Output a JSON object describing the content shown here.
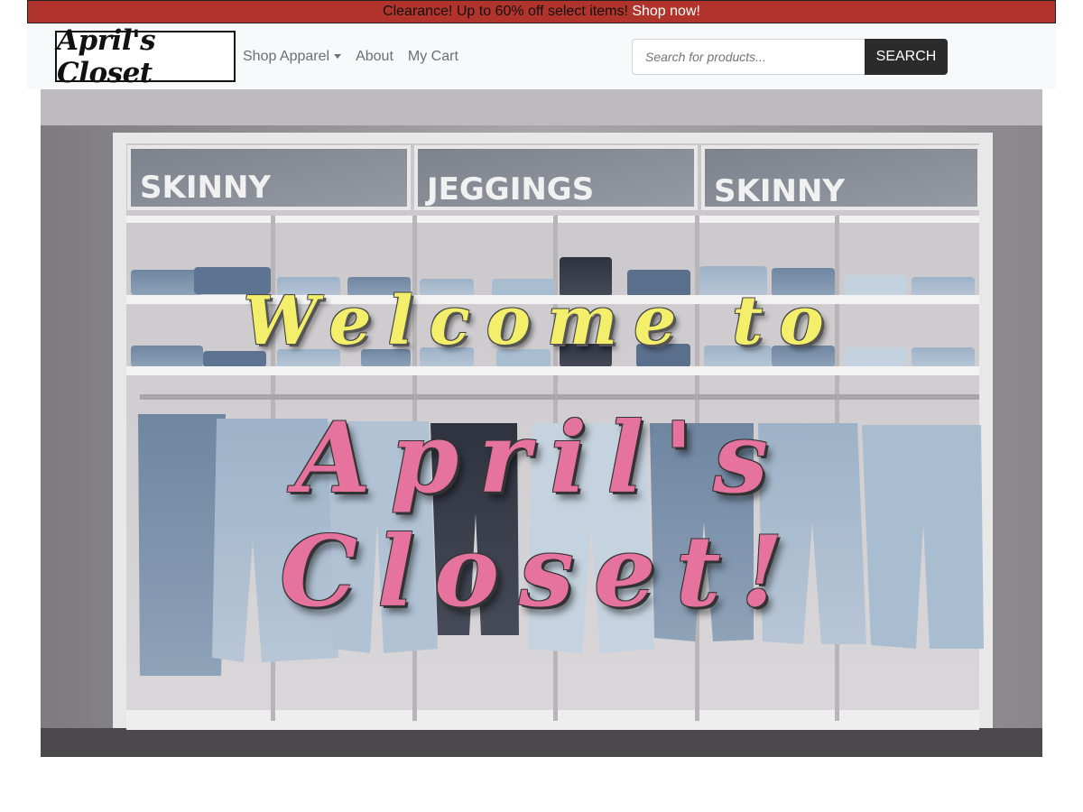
{
  "promo": {
    "text": "Clearance! Up to 60% off select items! ",
    "link_label": "Shop now!"
  },
  "navbar": {
    "brand": "April's Closet",
    "links": [
      {
        "label": "Shop Apparel",
        "dropdown": true
      },
      {
        "label": "About"
      },
      {
        "label": "My Cart"
      }
    ],
    "search": {
      "placeholder": "Search for products...",
      "value": "",
      "button_label": "SEARCH"
    }
  },
  "hero": {
    "line1": "Welcome to",
    "line2": "April's Closet!",
    "shelf_signs": [
      "SKINNY",
      "JEGGINGS",
      "SKINNY"
    ]
  },
  "colors": {
    "promo_bg": "#b0342b",
    "navbar_bg": "#f8f9fa",
    "search_button_bg": "#2b2b2b",
    "welcome_text": "#f3ef6a",
    "brand_text": "#e6739d"
  }
}
